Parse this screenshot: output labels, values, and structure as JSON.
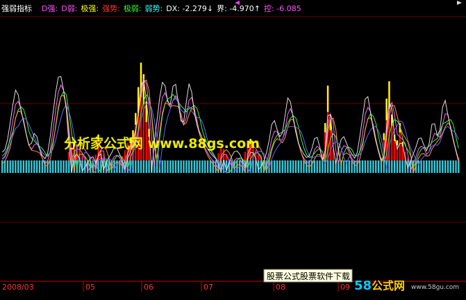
{
  "indicator": {
    "name": "强弱指标",
    "legend": [
      {
        "label": "D强:",
        "color": "#ff55ff"
      },
      {
        "label": "D弱:",
        "color": "#ff55ff"
      },
      {
        "label": "极强:",
        "color": "#ffff00"
      },
      {
        "label": "强势:",
        "color": "#ff3333"
      },
      {
        "label": "极弱:",
        "color": "#33ff33"
      },
      {
        "label": "弱势:",
        "color": "#33ffff"
      },
      {
        "label": "DX: -2.279",
        "arrow": "↓",
        "color": "#ffffff"
      },
      {
        "label": "界: -4.970",
        "arrow": "↑",
        "color": "#ffffff"
      },
      {
        "label": "控: -6.085",
        "arrow": "",
        "color": "#ff55ff"
      }
    ]
  },
  "watermark": {
    "text": "分析家公式网 www.88gs.com",
    "color": "#ffff00"
  },
  "footer": {
    "start_label": "2008/03",
    "month_labels": [
      "05",
      "06",
      "07",
      "08",
      "09"
    ],
    "tooltip": "股票公式股票软件下载",
    "brand_number": "58",
    "brand_text": "公式网",
    "brand_url": "www.58gu.com"
  },
  "colors": {
    "background": "#000000",
    "cyan_bars": "#33ccdd",
    "red_bars": "#ff0000",
    "yellow_tops": "#ffff00",
    "green_tails": "#33cc33",
    "gridline": "#660000",
    "axis": "#cc0000",
    "line_green": "#33ff33",
    "line_pink": "#ff66ff",
    "line_orange": "#ff9933",
    "line_blue": "#6666ff",
    "line_white": "#dddddd"
  },
  "chart_data": {
    "type": "bar",
    "title": "强弱指标",
    "x_start": "2008/03",
    "x_labels": [
      "2008/03",
      "05",
      "06",
      "07",
      "08",
      "09"
    ],
    "ylim": [
      -8,
      10
    ],
    "grid": true,
    "series": [
      {
        "name": "强势",
        "values": [
          -0.8,
          -1.2,
          -2.4,
          -3.8,
          -5.2,
          -6.0,
          -4.5,
          -3.6,
          -2.8,
          -1.6,
          -1.1,
          -1.9,
          -2.6,
          -1.4,
          -0.7,
          -0.4,
          -0.2,
          -1.2,
          -2.9,
          -4.6,
          -6.2,
          -7.0,
          -6.3,
          -4.9,
          -3.4,
          0.6,
          0.9,
          1.3,
          1.1,
          0.8,
          0.5,
          0.2,
          -0.1,
          -0.6,
          -0.3,
          0.4,
          1.8,
          0.7,
          0.4,
          -0.3,
          -0.5,
          -1.0,
          -1.4,
          -0.8,
          -0.5,
          0.3,
          0.7,
          1.2,
          1.6,
          2.1,
          3.3,
          5.1,
          6.8,
          6.0,
          4.1,
          2.2,
          -0.7,
          -2.3,
          -4.2,
          -5.8,
          -6.6,
          -5.3,
          -4.1,
          -4.9,
          -6.9,
          -5.2,
          -3.9,
          -2.5,
          -3.8,
          -5.7,
          -6.5,
          -4.4,
          -3.2,
          -2.6,
          -2.1,
          -1.6,
          -1.2,
          -0.9,
          -0.6,
          -0.4,
          -0.2,
          0.5,
          0.9,
          0.8,
          0.4,
          -0.3,
          -0.7,
          -1.0,
          -0.8,
          -0.5,
          0.1,
          0.6,
          1.2,
          1.5,
          1.2,
          0.7,
          0.4,
          0.2,
          -0.4,
          -1.1,
          -2.3,
          -3.6,
          -2.9,
          -2.2,
          -1.8,
          -2.8,
          -4.6,
          -5.4,
          -4.0,
          -2.9,
          -1.8,
          -1.2,
          -0.8,
          -0.5,
          -0.3,
          -0.7,
          -1.4,
          -2.3,
          -1.6,
          -0.8,
          0.4,
          2.6,
          5.2,
          2.8,
          0.8,
          -0.6,
          -1.4,
          -2.2,
          -1.8,
          -1.2,
          -0.8,
          -0.5,
          -0.2,
          -1.3,
          -2.8,
          -4.1,
          -5.7,
          -4.5,
          -3.2,
          -2.0,
          -1.3,
          -0.6,
          0.2,
          1.9,
          4.3,
          5.5,
          3.2,
          1.8,
          1.4,
          2.6,
          1.3,
          0.6,
          0.2,
          -0.4,
          -0.9,
          -1.5,
          -2.2,
          -1.6,
          -1.1,
          -0.7,
          -2.3,
          -3.6,
          -2.4,
          -1.8,
          -3.2,
          -5.4,
          -4.2,
          -3.1,
          -2.2,
          -1.3,
          -0.6,
          0.2
        ]
      }
    ]
  }
}
